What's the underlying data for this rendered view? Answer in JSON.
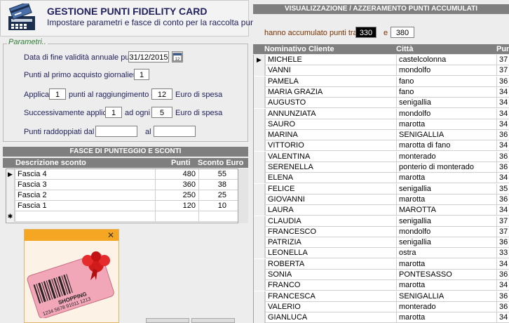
{
  "header": {
    "title": "GESTIONE PUNTI FIDELITY CARD",
    "subtitle": "Impostare parametri e fasce di conto per la raccolta punti"
  },
  "params": {
    "legend": "Parametri..",
    "end_date_label": "Data di fine validità annuale punti",
    "end_date_value": "31/12/2015",
    "calendar_label": "12",
    "first_purchase_label": "Punti al primo acquisto giornaliero",
    "first_purchase_value": "1",
    "apply_label": "Applica",
    "apply_value": "1",
    "apply_mid_label": "punti al raggiungimento di",
    "apply_threshold": "12",
    "apply_end_label": "Euro di spesa",
    "then_label": "Successivamente applica",
    "then_value": "1",
    "every_label": "ad ogni",
    "every_value": "5",
    "then_end_label": "Euro di spesa",
    "double_from_label": "Punti raddoppiati dal",
    "double_from_value": "",
    "double_to_label": "al",
    "double_to_value": ""
  },
  "bands": {
    "title": "FASCE DI PUNTEGGIO E SCONTI",
    "col_desc": "Descrizione sconto",
    "col_points": "Punti",
    "col_discount": "Sconto Euro",
    "rows": [
      {
        "desc": "Fascia 4",
        "points": "480",
        "discount": "55"
      },
      {
        "desc": "Fascia 3",
        "points": "360",
        "discount": "38"
      },
      {
        "desc": "Fascia 2",
        "points": "250",
        "discount": "25"
      },
      {
        "desc": "Fascia 1",
        "points": "120",
        "discount": "10"
      }
    ]
  },
  "card": {
    "close": "✕",
    "card_text": "SHOPPING",
    "card_number": "1234 5678 91011 1213"
  },
  "right": {
    "title": "VISUALIZZAZIONE / AZZERAMENTO PUNTI ACCUMULATI",
    "filter_label": "hanno accumulato punti tra",
    "filter_from": "330",
    "filter_and": "e",
    "filter_to": "380",
    "col_name": "Nominativo Cliente",
    "col_city": "Città",
    "col_points": "Pun",
    "rows": [
      {
        "name": "MICHELE",
        "city": "castelcolonna",
        "points": "37"
      },
      {
        "name": "VANNI",
        "city": "mondolfo",
        "points": "37"
      },
      {
        "name": "PAMELA",
        "city": "fano",
        "points": "36"
      },
      {
        "name": "MARIA GRAZIA",
        "city": "fano",
        "points": "34"
      },
      {
        "name": "AUGUSTO",
        "city": "senigallia",
        "points": "34"
      },
      {
        "name": "ANNUNZIATA",
        "city": "mondolfo",
        "points": "34"
      },
      {
        "name": "SAURO",
        "city": "marotta",
        "points": "34"
      },
      {
        "name": "MARINA",
        "city": "SENIGALLIA",
        "points": "36"
      },
      {
        "name": "VITTORIO",
        "city": "marotta di fano",
        "points": "34"
      },
      {
        "name": "VALENTINA",
        "city": "monterado",
        "points": "36"
      },
      {
        "name": "SERENELLA",
        "city": "ponterio di monterado",
        "points": "36"
      },
      {
        "name": "ELENA",
        "city": "marotta",
        "points": "34"
      },
      {
        "name": "FELICE",
        "city": "senigallia",
        "points": "35"
      },
      {
        "name": "GIOVANNI",
        "city": "marotta",
        "points": "36"
      },
      {
        "name": "LAURA",
        "city": "MAROTTA",
        "points": "34"
      },
      {
        "name": "CLAUDIA",
        "city": "senigallia",
        "points": "37"
      },
      {
        "name": "FRANCESCO",
        "city": "mondolfo",
        "points": "37"
      },
      {
        "name": "PATRIZIA",
        "city": "senigallia",
        "points": "36"
      },
      {
        "name": "LEONELLA",
        "city": "ostra",
        "points": "33"
      },
      {
        "name": "ROBERTA",
        "city": "marotta",
        "points": "34"
      },
      {
        "name": "SONIA",
        "city": "PONTESASSO",
        "points": "36"
      },
      {
        "name": "FRANCO",
        "city": "marotta",
        "points": "34"
      },
      {
        "name": "FRANCESCA",
        "city": "SENIGALLIA",
        "points": "36"
      },
      {
        "name": "VALERIO",
        "city": "monterado",
        "points": "36"
      },
      {
        "name": "GIANLUCA",
        "city": "marotta",
        "points": "34"
      }
    ]
  }
}
